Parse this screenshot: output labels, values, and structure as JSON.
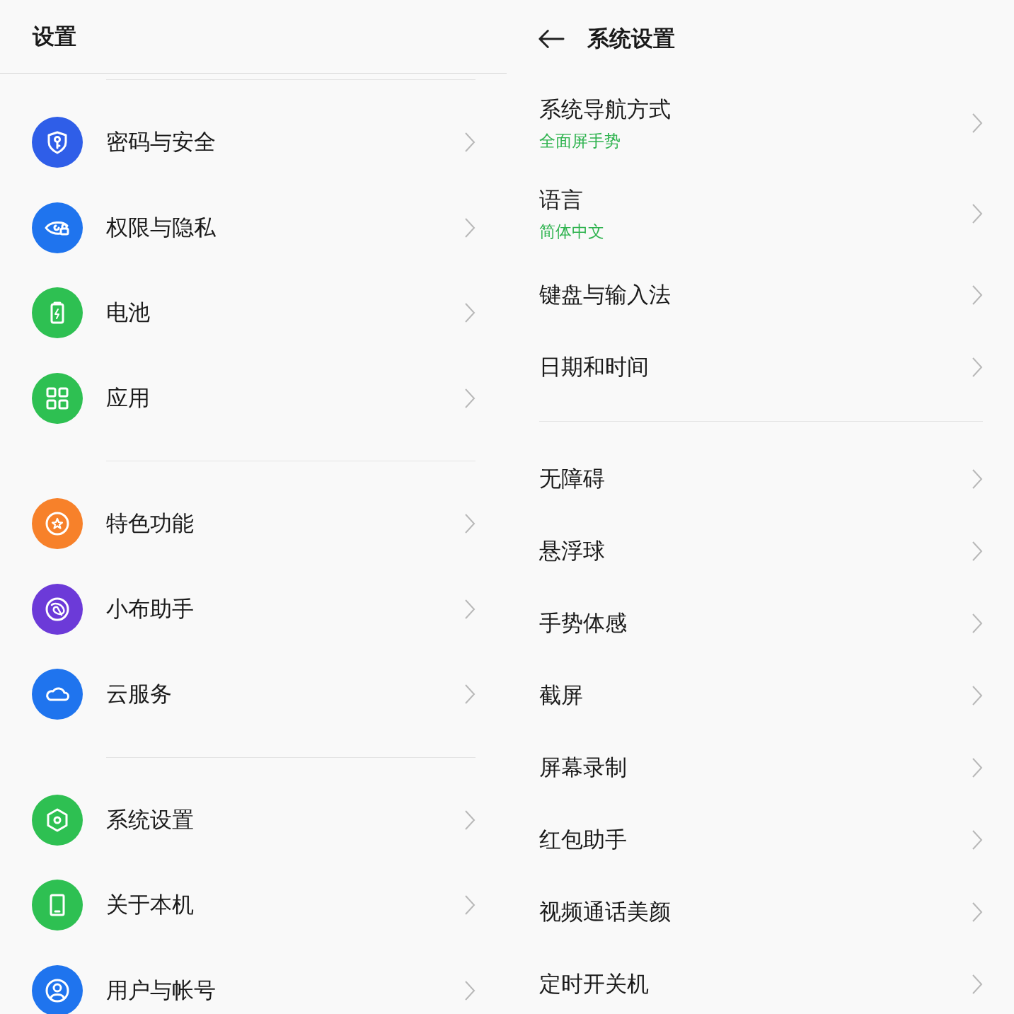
{
  "left": {
    "title": "设置",
    "groups": [
      {
        "items": [
          {
            "label": "密码与安全",
            "kind": "shield-key",
            "color": "#2f5ee8"
          },
          {
            "label": "权限与隐私",
            "kind": "eye-lock",
            "color": "#1f74ee"
          },
          {
            "label": "电池",
            "kind": "battery",
            "color": "#2ec052"
          },
          {
            "label": "应用",
            "kind": "grid",
            "color": "#2ec052"
          }
        ]
      },
      {
        "items": [
          {
            "label": "特色功能",
            "kind": "star",
            "color": "#f7812a"
          },
          {
            "label": "小布助手",
            "kind": "assistant",
            "color": "#6c3ad8"
          },
          {
            "label": "云服务",
            "kind": "cloud",
            "color": "#1f74ee"
          }
        ]
      },
      {
        "items": [
          {
            "label": "系统设置",
            "kind": "hexagon",
            "color": "#2ec052"
          },
          {
            "label": "关于本机",
            "kind": "phone",
            "color": "#2ec052"
          },
          {
            "label": "用户与帐号",
            "kind": "user",
            "color": "#1f74ee"
          }
        ]
      }
    ]
  },
  "right": {
    "title": "系统设置",
    "sections": [
      {
        "items": [
          {
            "label": "系统导航方式",
            "value": "全面屏手势"
          },
          {
            "label": "语言",
            "value": "简体中文"
          },
          {
            "label": "键盘与输入法"
          },
          {
            "label": "日期和时间"
          }
        ]
      },
      {
        "items": [
          {
            "label": "无障碍"
          },
          {
            "label": "悬浮球"
          },
          {
            "label": "手势体感"
          },
          {
            "label": "截屏"
          },
          {
            "label": "屏幕录制"
          },
          {
            "label": "红包助手"
          },
          {
            "label": "视频通话美颜"
          },
          {
            "label": "定时开关机"
          }
        ]
      }
    ]
  }
}
